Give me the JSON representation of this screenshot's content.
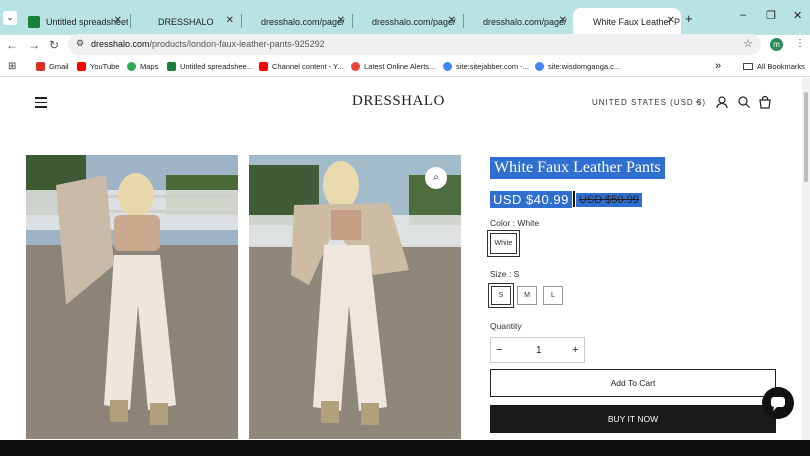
{
  "browser": {
    "tabs": [
      {
        "label": "Untitled spreadsheet",
        "favicon": "sheets-icon"
      },
      {
        "label": "DRESSHALO",
        "favicon": "page-icon"
      },
      {
        "label": "dresshalo.com/page/",
        "favicon": "page-icon"
      },
      {
        "label": "dresshalo.com/page/",
        "favicon": "page-icon"
      },
      {
        "label": "dresshalo.com/page/",
        "favicon": "page-icon"
      },
      {
        "label": "White Faux Leather P",
        "favicon": "page-icon",
        "active": true
      }
    ],
    "new_tab": "+",
    "window_controls": {
      "minimize": "–",
      "restore": "❐",
      "close": "✕"
    },
    "url_domain": "dresshalo.com",
    "url_path": "/products/london-faux-leather-pants-925292",
    "profile_initial": "m",
    "bookmarks": [
      {
        "label": "Gmail",
        "color": "#d93025"
      },
      {
        "label": "YouTube",
        "color": "#ff0000"
      },
      {
        "label": "Maps",
        "color": "#34a853"
      },
      {
        "label": "Untitled spreadshee...",
        "color": "#188038"
      },
      {
        "label": "Channel content - Y...",
        "color": "#ff0000"
      },
      {
        "label": "Latest Online Alerts...",
        "color": "#e8453c"
      },
      {
        "label": "site:sitejabber.com -...",
        "color": "#4285f4"
      },
      {
        "label": "site:wisdomganga.c...",
        "color": "#4285f4"
      }
    ],
    "more_bookmarks": "»",
    "all_bookmarks": "All Bookmarks"
  },
  "store": {
    "logo": "DRESSHALO",
    "country": "UNITED STATES (USD $)",
    "product": {
      "title": "White Faux Leather Pants",
      "price": "USD $40.99",
      "compare_price": "USD $50.99",
      "color_label": "Color : White",
      "color_options": [
        "White"
      ],
      "size_label": "Size : S",
      "size_options": [
        "S",
        "M",
        "L"
      ],
      "quantity_label": "Quantity",
      "quantity_value": "1",
      "decrement": "−",
      "increment": "+",
      "add_to_cart": "Add To Cart",
      "buy_now": "BUY IT NOW"
    }
  },
  "colors": {
    "tabbar": "#b9e2e2",
    "selection": "#2f6fcf",
    "buy_button": "#1a1a1a"
  }
}
